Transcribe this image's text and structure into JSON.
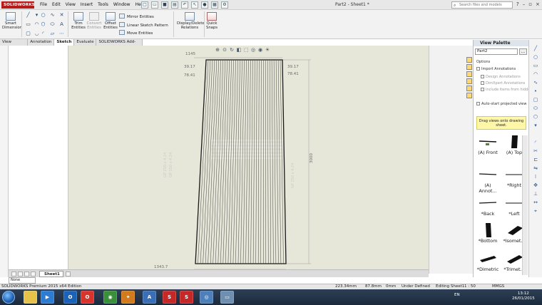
{
  "app": {
    "logo_text": "SOLIDWORKS",
    "title": "Part2 - Sheet1 *",
    "menu": [
      "File",
      "Edit",
      "View",
      "Insert",
      "Tools",
      "Window",
      "Help"
    ],
    "search_placeholder": "Search files and models"
  },
  "toolbar": {
    "smart_dimension": "Smart\nDimension",
    "trim_entities": "Trim\nEntities",
    "convert_entities": "Convert\nEntities",
    "offset_entities": "Offset\nEntities",
    "mirror_entities": "Mirror Entities",
    "linear_sketch_pattern": "Linear Sketch Pattern",
    "move_entities": "Move Entities",
    "display_delete_relations": "Display/Delete\nRelations",
    "quick_snaps": "Quick\nSnaps"
  },
  "tabs": [
    {
      "label": "View Layout",
      "active": false
    },
    {
      "label": "Annotation",
      "active": false
    },
    {
      "label": "Sketch",
      "active": true
    },
    {
      "label": "Evaluate",
      "active": false
    },
    {
      "label": "SOLIDWORKS Add-Ins",
      "active": false
    }
  ],
  "drawing": {
    "dim_top": "1145",
    "dim_left_1": "39.17",
    "dim_left_2": "78.41",
    "dim_right_1": "39.17",
    "dim_right_2": "78.41",
    "dim_height": "3000",
    "dim_bottom": "1343.7",
    "faint_label_1": "GP 250 x 4.24",
    "faint_label_2": "GP 250 x 4.24",
    "faint_label_3": "GP 250 x 4.24"
  },
  "sheet_tab": "Sheet1",
  "unit_select": "None",
  "palette": {
    "title": "View Palette",
    "document": "Part2",
    "options_label": "Options",
    "import_annotations": "Import Annotations",
    "design_annotations": "Design Annotations",
    "dimxpert_annotations": "DimXpert Annotations",
    "include_hidden": "Include items from hidden f",
    "auto_start": "Auto-start projected view",
    "tip": "Drag views onto drawing sheet.",
    "views": [
      "(A) Front",
      "(A) Top",
      "(A) Annot...",
      "*Right",
      "*Back",
      "*Left",
      "*Bottom",
      "*Isomet...",
      "*Dimetric",
      "*Trimet..."
    ]
  },
  "status": {
    "edition": "SOLIDWORKS Premium 2015 x64 Edition",
    "x": "223.34mm",
    "y": "87.8mm",
    "z": "0mm",
    "state": "Under Defined",
    "editing": "Editing Sheet1",
    "scale": "1 : 50",
    "units": "MMGS"
  },
  "taskbar": {
    "lang": "EN",
    "time": "13:12",
    "date": "26/01/2015"
  }
}
